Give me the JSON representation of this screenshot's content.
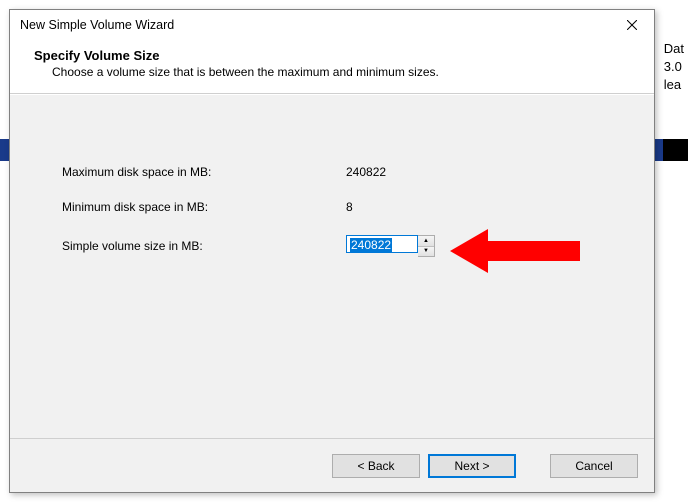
{
  "backdrop": {
    "side1": "Dat",
    "side2": "3.0",
    "side3": "lea"
  },
  "dialog": {
    "title": "New Simple Volume Wizard",
    "header": {
      "title": "Specify Volume Size",
      "subtitle": "Choose a volume size that is between the maximum and minimum sizes."
    },
    "fields": {
      "max_label": "Maximum disk space in MB:",
      "max_value": "240822",
      "min_label": "Minimum disk space in MB:",
      "min_value": "8",
      "size_label": "Simple volume size in MB:",
      "size_value": "240822"
    },
    "buttons": {
      "back": "< Back",
      "next": "Next >",
      "cancel": "Cancel"
    }
  }
}
